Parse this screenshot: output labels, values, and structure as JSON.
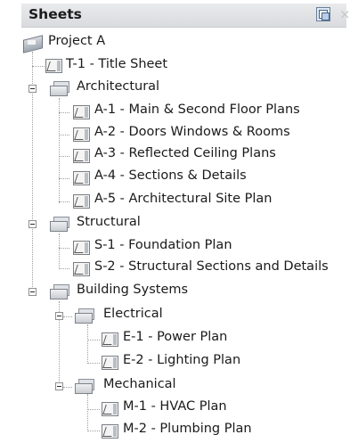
{
  "panel": {
    "title": "Sheets",
    "close_glyph": "×",
    "button_icon": "sheet-list-toggle-icon"
  },
  "tree": {
    "project": "Project A",
    "title_sheet": "T-1 - Title Sheet",
    "architectural": {
      "label": "Architectural",
      "sheets": [
        "A-1 - Main & Second Floor Plans",
        "A-2 - Doors Windows & Rooms",
        "A-3 - Reflected Ceiling Plans",
        "A-4 - Sections & Details",
        "A-5 - Architectural Site Plan"
      ]
    },
    "structural": {
      "label": "Structural",
      "sheets": [
        "S-1 - Foundation Plan",
        "S-2 - Structural Sections and Details"
      ]
    },
    "building_systems": {
      "label": "Building Systems",
      "electrical": {
        "label": "Electrical",
        "sheets": [
          "E-1 - Power Plan",
          "E-2 - Lighting Plan"
        ]
      },
      "mechanical": {
        "label": "Mechanical",
        "sheets": [
          "M-1 - HVAC Plan",
          "M-2 - Plumbing Plan"
        ]
      }
    }
  }
}
